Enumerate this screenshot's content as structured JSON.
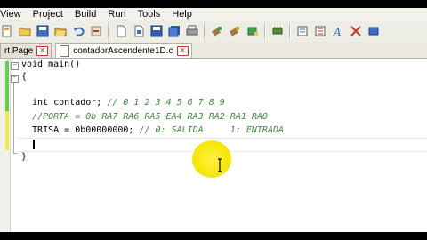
{
  "menu": [
    "View",
    "Project",
    "Build",
    "Run",
    "Tools",
    "Help"
  ],
  "toolbar": {
    "icons": [
      "new-project-icon",
      "open-project-icon",
      "save-icon",
      "open-folder-icon",
      "undo-icon",
      "redo-icon",
      "new-file-icon",
      "open-file-icon",
      "save-file-icon",
      "save-all-icon",
      "print-icon",
      "compile-icon",
      "build-icon",
      "debug-icon",
      "programmer-icon",
      "view-icon",
      "registers-icon",
      "font-icon",
      "exit-icon"
    ]
  },
  "tabs": [
    {
      "label": "rt Page",
      "active": false
    },
    {
      "label": "contadorAscendente1D.c",
      "active": true
    }
  ],
  "editor": {
    "lines": [
      {
        "code": "void main()",
        "comment": ""
      },
      {
        "code": "{",
        "comment": ""
      },
      {
        "code": "",
        "comment": ""
      },
      {
        "code": "  int contador; ",
        "comment": "// 0 1 2 3 4 5 6 7 8 9"
      },
      {
        "code": "  ",
        "comment": "//PORTA = 0b RA7 RA6 RA5 EA4 RA3 RA2 RA1 RA0"
      },
      {
        "code": "  TRISA = 0b00000000; ",
        "comment": "// 0: SALIDA     1: ENTRADA"
      },
      {
        "code": "",
        "comment": ""
      },
      {
        "code": "}",
        "comment": ""
      }
    ]
  },
  "colors": {
    "comment": "#3b8a3a",
    "highlight": "#f7e600",
    "modified_marker": "#f2e84a",
    "saved_marker": "#5fcf4e"
  }
}
